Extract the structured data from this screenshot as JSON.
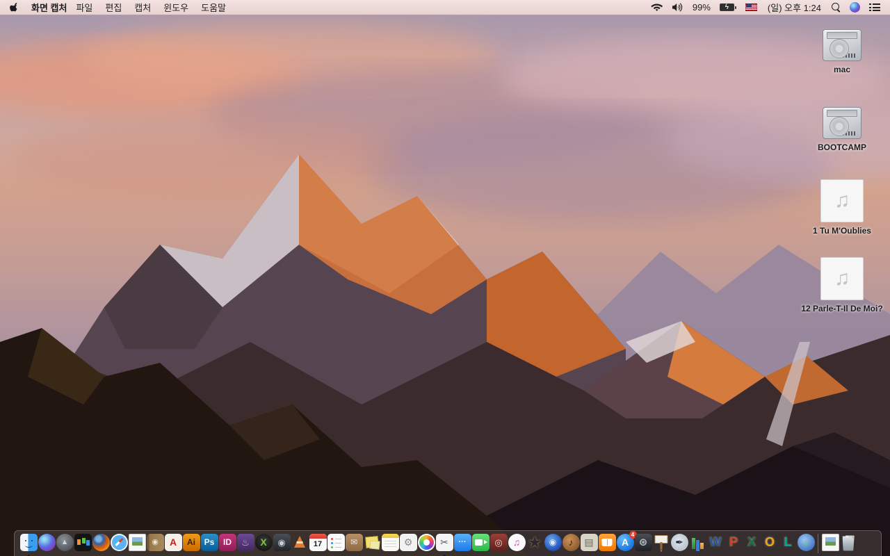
{
  "menubar": {
    "app_name": "화면 캡처",
    "menus": [
      "파일",
      "편집",
      "캡처",
      "윈도우",
      "도움말"
    ],
    "status": {
      "battery_percent": "99%",
      "battery_state": "charging",
      "bolt_glyph": "ϟ",
      "clock": "(일) 오후 1:24",
      "wifi_icon": "wifi-full",
      "volume_icon": "volume-on",
      "input_flag": "us-flag",
      "spotlight_icon": "magnifier",
      "siri_icon": "siri-orb",
      "notification_icon": "list-lines"
    }
  },
  "desktop": {
    "icons": [
      {
        "name": "volume-mac",
        "label": "mac",
        "type": "drive"
      },
      {
        "name": "volume-bootcamp",
        "label": "BOOTCAMP",
        "type": "drive"
      },
      {
        "name": "audio-file-tu-moublies",
        "label": "1 Tu M'Oublies",
        "type": "audio",
        "note_glyph": "♫"
      },
      {
        "name": "audio-file-parle-t-il-de-moi",
        "label": "12 Parle-T-Il De Moi?",
        "type": "audio",
        "note_glyph": "♫"
      }
    ]
  },
  "dock": {
    "trash_state": "full",
    "items": [
      {
        "name": "finder-app-icon",
        "kind": "finder",
        "running": true
      },
      {
        "name": "siri-app-icon",
        "shape": "circle",
        "bg": "radial-gradient(circle at 35% 32%, #8fe0ef 8%, #5a6ae4 48%, #8a3ab4 78%, #2a1a50 100%)"
      },
      {
        "name": "launchpad-app-icon",
        "shape": "circle",
        "bg": "radial-gradient(circle at 40% 35%, #8a8f96, #55595f 70%, #3f4247)",
        "glyph": "▲",
        "fg": "#cfd3d8",
        "size": "11px"
      },
      {
        "name": "mission-control-app-icon",
        "kind": "missionctl"
      },
      {
        "name": "firefox-app-icon",
        "shape": "circle",
        "bg": "radial-gradient(circle at 35% 30%, #7ab2e0 16%, #3a5f9a 30%, #e66000 58%, #ffb13a 88%)"
      },
      {
        "name": "safari-app-icon",
        "kind": "safari"
      },
      {
        "name": "preview-app-icon",
        "kind": "photo-doc"
      },
      {
        "name": "contacts-app-icon",
        "bg": "linear-gradient(90deg,#6e5638 0 14%, #96754c 14%, #a98a5e)",
        "glyph": "◉",
        "fg": "#efe4d0",
        "size": "11px"
      },
      {
        "name": "acrobat-app-icon",
        "bg": "#f5f0ea",
        "glyph": "A",
        "fg": "#d01c1c",
        "size": "14px"
      },
      {
        "name": "illustrator-app-icon",
        "bg": "linear-gradient(180deg,#f09a1a,#c96a00)",
        "glyph": "Ai",
        "fg": "#3a2000"
      },
      {
        "name": "photoshop-app-icon",
        "bg": "linear-gradient(180deg,#2a90c8,#0a5a96)",
        "glyph": "Ps",
        "fg": "#eaf6ff"
      },
      {
        "name": "indesign-app-icon",
        "bg": "linear-gradient(180deg,#c2347c,#8e1f56)",
        "glyph": "ID",
        "fg": "#ffe8f4"
      },
      {
        "name": "toast-app-icon",
        "bg": "linear-gradient(180deg,#6a4a92,#43285e)",
        "glyph": "♨",
        "fg": "#cdb8e8",
        "size": "13px"
      },
      {
        "name": "media-x-app-icon",
        "shape": "circle",
        "bg": "radial-gradient(circle at 50% 40%, #3a3a3a, #0a0a0a)",
        "glyph": "X",
        "fg": "#7ac943",
        "size": "14px"
      },
      {
        "name": "disk-app-icon",
        "bg": "linear-gradient(180deg,#4a4e55,#22252a)",
        "glyph": "◉",
        "fg": "#c8ccd4",
        "size": "13px"
      },
      {
        "name": "vlc-app-icon",
        "kind": "vlc"
      },
      {
        "name": "calendar-app-icon",
        "kind": "calendar",
        "glyph": "17"
      },
      {
        "name": "reminders-app-icon",
        "kind": "reminders"
      },
      {
        "name": "letter-box-app-icon",
        "bg": "linear-gradient(180deg,#b89068,#8f6a42)",
        "glyph": "✉",
        "fg": "#f0e8dc",
        "size": "12px"
      },
      {
        "name": "stickies-app-icon",
        "kind": "stickies"
      },
      {
        "name": "notes-app-icon",
        "kind": "notes"
      },
      {
        "name": "image-tool-app-icon",
        "bg": "#f2f2f2",
        "glyph": "⚙",
        "fg": "#8a8a8a",
        "size": "14px"
      },
      {
        "name": "photos-app-icon",
        "kind": "photos"
      },
      {
        "name": "screen-capture-grab-app-icon",
        "bg": "#f4f4f4",
        "glyph": "✂",
        "fg": "#55585e",
        "size": "14px",
        "running": true
      },
      {
        "name": "messages-app-icon",
        "bg": "linear-gradient(180deg,#5ab0f8,#1d7ae8)",
        "glyph": "···",
        "fg": "#ffffff",
        "size": "11px"
      },
      {
        "name": "facetime-app-icon",
        "kind": "facetime",
        "bg": "linear-gradient(180deg,#6ae07a,#2bb84a)"
      },
      {
        "name": "photo-booth-app-icon",
        "bg": "linear-gradient(180deg,#9a4038,#5e201c)",
        "glyph": "◎",
        "fg": "#e8d8d0",
        "size": "13px"
      },
      {
        "name": "itunes-app-icon",
        "shape": "circle",
        "bg": "#fafafa",
        "glyph": "♫",
        "fg": "#d44fae",
        "size": "14px"
      },
      {
        "name": "imovie-app-icon",
        "kind": "star",
        "glyph": "★",
        "fg": "#2b2833"
      },
      {
        "name": "dvd-app-icon",
        "shape": "circle",
        "bg": "radial-gradient(circle at 40% 35%, #6aa8e8, #2a5ac0 60%, #16306e)",
        "glyph": "◉",
        "fg": "rgba(255,255,255,.8)",
        "size": "12px"
      },
      {
        "name": "garageband-app-icon",
        "shape": "circle",
        "bg": "radial-gradient(circle at 40% 35%, #c89058, #7a4a20)",
        "glyph": "♪",
        "fg": "#3a2410",
        "size": "14px"
      },
      {
        "name": "newspaper-app-icon",
        "bg": "#d8d4c8",
        "glyph": "▤",
        "fg": "#6a665a",
        "size": "14px"
      },
      {
        "name": "ibooks-app-icon",
        "kind": "ibooks",
        "bg": "linear-gradient(180deg,#ffa23a,#f07800)"
      },
      {
        "name": "app-store-app-icon",
        "shape": "circle",
        "bg": "radial-gradient(circle at 35% 30%, #6ab8f8, #1a7ae0 70%, #0a5ab8)",
        "glyph": "A",
        "fg": "#ffffff",
        "size": "14px",
        "badge": "4"
      },
      {
        "name": "wheel-app-icon",
        "bg": "linear-gradient(180deg,#4a4e55,#1d2025)",
        "glyph": "⊛",
        "fg": "#b8bcc4",
        "size": "15px"
      },
      {
        "name": "keynote-app-icon",
        "kind": "keynote"
      },
      {
        "name": "pages-inkwell-app-icon",
        "shape": "circle",
        "bg": "radial-gradient(circle at 45% 40%, #dfe6ee, #aab4c0)",
        "glyph": "✒",
        "fg": "#1f2430",
        "size": "14px"
      },
      {
        "name": "numbers-chart-app-icon",
        "kind": "numbers"
      },
      {
        "name": "word-app-icon",
        "kind": "letter3d",
        "glyph": "W",
        "fg": "#2b579a"
      },
      {
        "name": "powerpoint-app-icon",
        "kind": "letter3d",
        "glyph": "P",
        "fg": "#d04423"
      },
      {
        "name": "excel-app-icon",
        "kind": "letter3d",
        "glyph": "X",
        "fg": "#1e7145"
      },
      {
        "name": "outlook-app-icon",
        "kind": "letter3d",
        "glyph": "O",
        "fg": "#eda418"
      },
      {
        "name": "lync-app-icon",
        "kind": "letter3d",
        "glyph": "L",
        "fg": "#00a88e"
      },
      {
        "name": "globe-download-app-icon",
        "shape": "circle",
        "bg": "radial-gradient(circle at 40% 35%, #9ac8f0, #4a7ac8 70%, #2a4a88)",
        "glyph": "↓",
        "fg": "#5ad44a",
        "size": "14px"
      },
      {
        "name": "dock-divider",
        "kind": "divider"
      },
      {
        "name": "image-document-icon",
        "kind": "photo-doc"
      },
      {
        "name": "trash-icon",
        "kind": "trash"
      }
    ]
  }
}
